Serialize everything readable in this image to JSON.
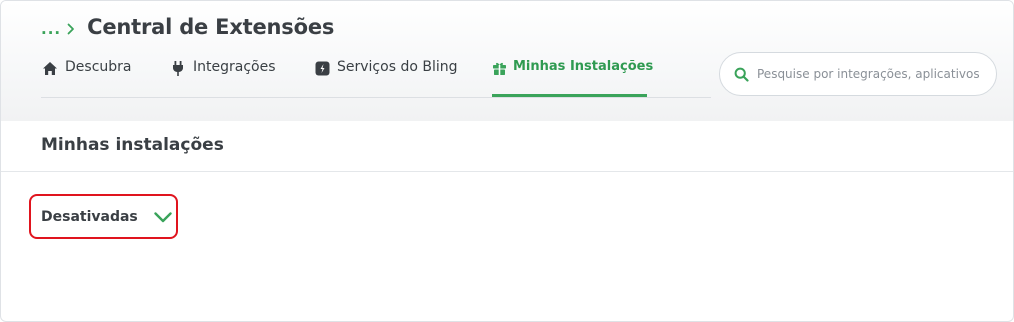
{
  "breadcrumb": {
    "ellipsis": "...",
    "title": "Central de Extensões"
  },
  "tabs": [
    {
      "label": "Descubra",
      "icon": "home-icon",
      "active": false
    },
    {
      "label": "Integrações",
      "icon": "plug-icon",
      "active": false
    },
    {
      "label": "Serviços do Bling",
      "icon": "bling-icon",
      "active": false
    },
    {
      "label": "Minhas Instalações",
      "icon": "gift-icon",
      "active": true
    }
  ],
  "search": {
    "placeholder": "Pesquise por integrações, aplicativos",
    "icon": "search-icon"
  },
  "section": {
    "title": "Minhas instalações"
  },
  "filter": {
    "label": "Desativadas",
    "icon": "chevron-down-icon"
  },
  "colors": {
    "accent": "#3aa35a",
    "highlight_border": "#e0141e",
    "text": "#3a3f44"
  }
}
